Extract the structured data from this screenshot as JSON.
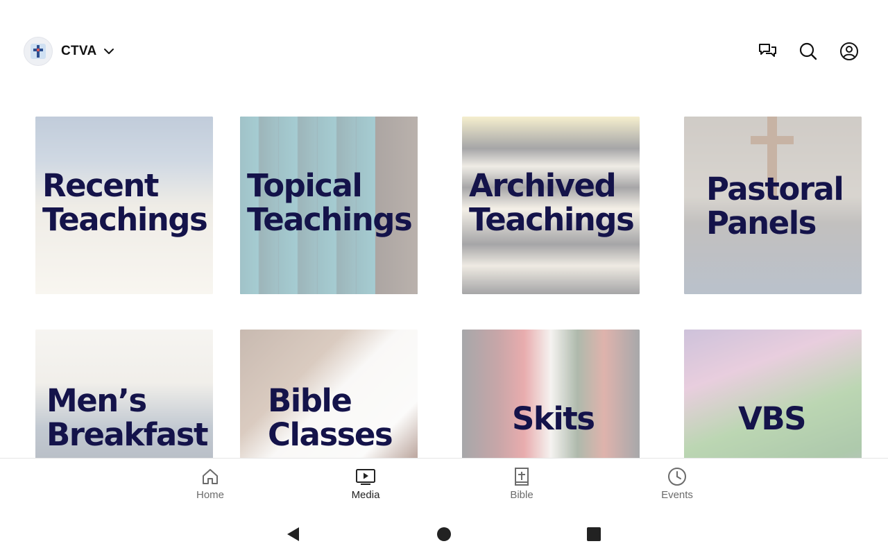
{
  "header": {
    "org_name": "CTVA",
    "logo_icon": "church-cross-logo-icon",
    "actions": [
      "chat-icon",
      "search-icon",
      "account-icon"
    ]
  },
  "tiles": [
    {
      "line1": "Recent",
      "line2": "Teachings",
      "image": "open-bible-photo"
    },
    {
      "line1": "Topical",
      "line2": "Teachings",
      "image": "theology-books-photo"
    },
    {
      "line1": "Archived",
      "line2": "Teachings",
      "image": "stacked-bibles-photo"
    },
    {
      "line1": "Pastoral",
      "line2": "Panels",
      "image": "pastors-panel-photo"
    },
    {
      "line1": "Men’s",
      "line2": "Breakfast",
      "image": "mens-meeting-photo"
    },
    {
      "line1": "Bible",
      "line2": "Classes",
      "image": "notebook-bible-photo"
    },
    {
      "line1": "Skits",
      "line2": "",
      "image": "skit-actors-photo"
    },
    {
      "line1": "VBS",
      "line2": "",
      "image": "vbs-mural-photo"
    }
  ],
  "nav": {
    "items": [
      {
        "label": "Home",
        "icon": "home-icon",
        "active": false
      },
      {
        "label": "Media",
        "icon": "media-play-icon",
        "active": true
      },
      {
        "label": "Bible",
        "icon": "bible-icon",
        "active": false
      },
      {
        "label": "Events",
        "icon": "clock-icon",
        "active": false
      }
    ]
  },
  "system_nav": [
    "back-icon",
    "home-circle-icon",
    "recents-square-icon"
  ],
  "colors": {
    "title_text": "#14134a",
    "active_nav": "#222222",
    "inactive_nav": "#6b6b6b"
  }
}
